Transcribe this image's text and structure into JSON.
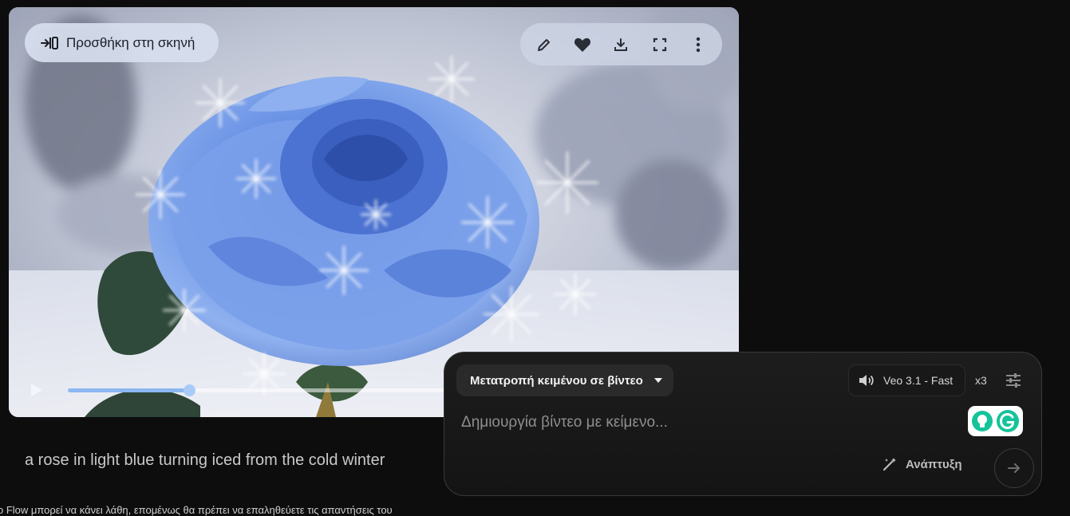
{
  "video": {
    "add_to_scene_label": "Προσθήκη στη σκηνή",
    "add_to_scene_icon": "add-to-scene-icon",
    "tools": [
      "edit-icon",
      "heart-icon",
      "download-icon",
      "fullscreen-icon",
      "more-vert-icon"
    ],
    "progress_fraction": 0.31
  },
  "prompt_text": "a rose in light blue turning iced from the cold winter",
  "disclaimer": "o Flow μπορεί να κάνει λάθη, επομένως θα πρέπει να επαληθεύετε τις απαντήσεις του",
  "composer": {
    "mode_label": "Μετατροπή κειμένου σε βίντεο",
    "model_label": "Veo 3.1 - Fast",
    "count_label": "x3",
    "input_placeholder": "Δημιουργία βίντεο με κείμενο...",
    "input_value": "",
    "expand_label": "Ανάπτυξη"
  },
  "colors": {
    "page_background": "#0d0d0d",
    "composer_background": "#1a1a1a",
    "accent_progress": "#8cb8f2",
    "grammarly_green": "#15c39a"
  }
}
